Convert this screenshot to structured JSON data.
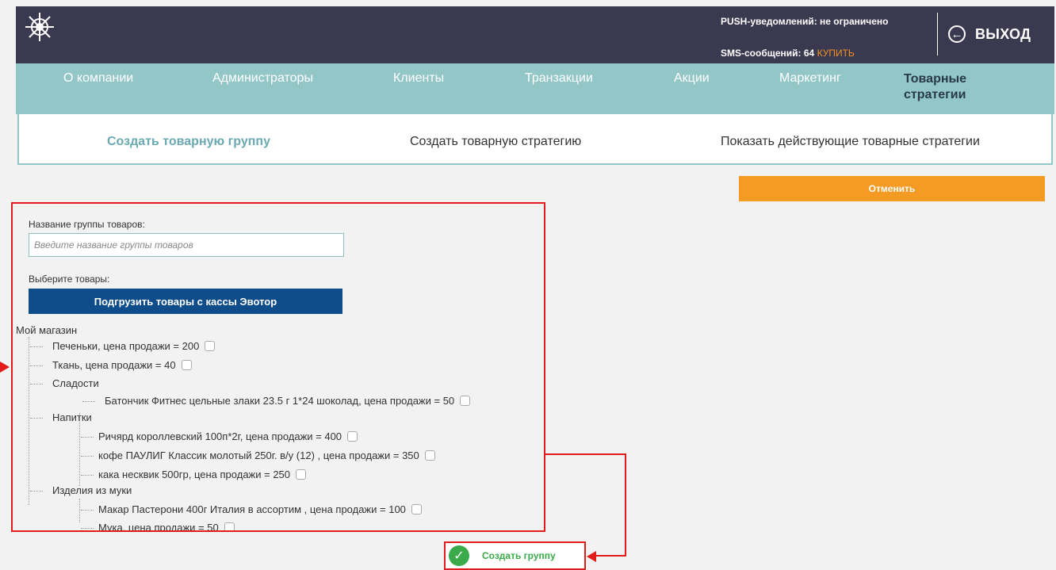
{
  "header": {
    "push_text": "PUSH-уведомлений: не ограничено",
    "sms_text": "SMS-сообщений: 64",
    "buy_label": "КУПИТЬ",
    "logout_label": "ВЫХОД",
    "logout_icon": "arrow-left-circle-icon",
    "logo_icon": "ship-wheel-icon"
  },
  "nav": {
    "items": [
      {
        "label": "О компании"
      },
      {
        "label": "Администраторы"
      },
      {
        "label": "Клиенты"
      },
      {
        "label": "Транзакции"
      },
      {
        "label": "Акции"
      },
      {
        "label": "Маркетинг"
      },
      {
        "label": "Товарные стратегии"
      }
    ],
    "active": "Товарные стратегии"
  },
  "subnav": {
    "items": [
      {
        "label": "Создать товарную группу"
      },
      {
        "label": "Создать товарную стратегию"
      },
      {
        "label": "Показать действующие товарные стратегии"
      }
    ],
    "active": "Создать товарную группу"
  },
  "actions": {
    "cancel_label": "Отменить",
    "create_label": "Создать группу",
    "create_icon": "check-circle-icon"
  },
  "form": {
    "name_label": "Название группы товаров:",
    "name_placeholder": "Введите название группы товаров",
    "name_value": "",
    "products_label": "Выберите товары:",
    "load_button": "Подгрузить товары с кассы Эвотор"
  },
  "tree": {
    "root": "Мой магазин",
    "items": [
      {
        "label": "Печеньки, цена продажи = 200",
        "checked": false
      },
      {
        "label": "Ткань, цена продажи = 40",
        "checked": false
      },
      {
        "label": "Сладости",
        "group": true
      },
      {
        "label": "Батончик Фитнес цельные злаки 23.5 г 1*24 шоколад, цена продажи = 50",
        "checked": false
      },
      {
        "label": "Напитки",
        "group": true
      },
      {
        "label": "Ричярд короллевский 100п*2г, цена продажи = 400",
        "checked": false
      },
      {
        "label": "кофе ПАУЛИГ Классик молотый 250г. в/у (12) , цена продажи = 350",
        "checked": false
      },
      {
        "label": "кака несквик 500гр, цена продажи = 250",
        "checked": false
      },
      {
        "label": "Изделия из муки",
        "group": true
      },
      {
        "label": "Макар Пастерони 400г Италия в ассортим , цена продажи = 100",
        "checked": false
      },
      {
        "label": "Мука, цена продажи = 50",
        "checked": false
      }
    ]
  },
  "colors": {
    "topbar": "#3a3950",
    "nav": "#93c6c7",
    "accent_orange": "#f59a23",
    "load_button": "#0f4c8a",
    "highlight_red": "#e31b1b",
    "success_green": "#3aaa4a"
  }
}
